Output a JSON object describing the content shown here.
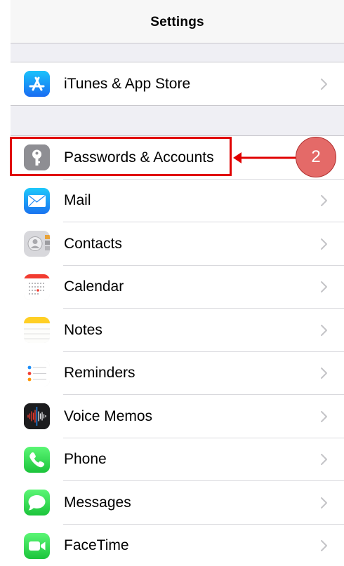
{
  "nav": {
    "title": "Settings"
  },
  "group1": [
    {
      "label": "iTunes & App Store",
      "icon": "app-store-icon",
      "color": "#1a8cfb"
    }
  ],
  "group2": [
    {
      "label": "Passwords & Accounts",
      "icon": "key-icon",
      "color": "#8e8e93"
    },
    {
      "label": "Mail",
      "icon": "mail-icon",
      "color": "#1e8ef7"
    },
    {
      "label": "Contacts",
      "icon": "contacts-icon",
      "color": "#c7c7cc"
    },
    {
      "label": "Calendar",
      "icon": "calendar-icon",
      "color": "#ffffff"
    },
    {
      "label": "Notes",
      "icon": "notes-icon",
      "color": "#ffd60a"
    },
    {
      "label": "Reminders",
      "icon": "reminders-icon",
      "color": "#ffffff"
    },
    {
      "label": "Voice Memos",
      "icon": "voice-memos-icon",
      "color": "#1c1c1e"
    },
    {
      "label": "Phone",
      "icon": "phone-icon",
      "color": "#32c95a"
    },
    {
      "label": "Messages",
      "icon": "messages-icon",
      "color": "#32c95a"
    },
    {
      "label": "FaceTime",
      "icon": "facetime-icon",
      "color": "#32c95a"
    }
  ],
  "annotation": {
    "step": "2",
    "color": "#e00000"
  }
}
